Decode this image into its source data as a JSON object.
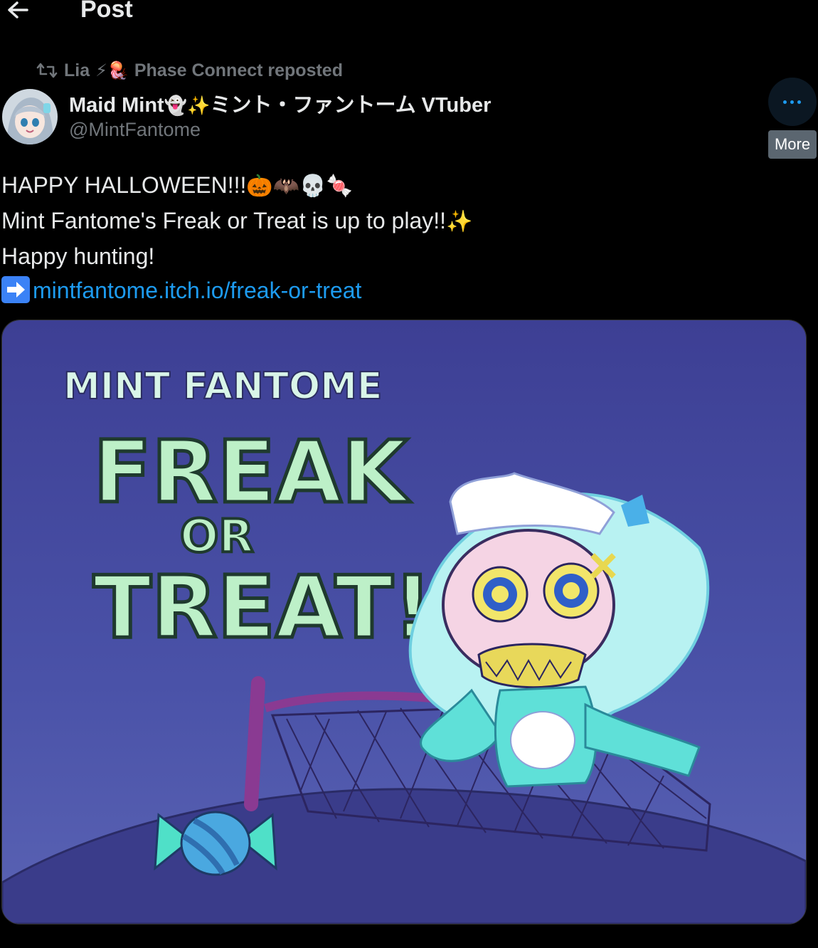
{
  "header": {
    "title": "Post"
  },
  "repost": {
    "user": "Lia",
    "emoji": "⚡🪼",
    "label": "Phase Connect reposted"
  },
  "author": {
    "display_name_prefix": "Maid Mint",
    "display_name_emoji": "👻✨",
    "display_name_suffix": "ミント・ファントーム VTuber",
    "handle": "@MintFantome"
  },
  "more": {
    "tooltip": "More"
  },
  "post": {
    "line1_text": "HAPPY HALLOWEEN!!!",
    "line1_emoji": "🎃🦇💀🍬",
    "line2_text": "Mint Fantome's Freak or Treat is up to play!!",
    "line2_emoji": "✨",
    "line3_text": "Happy hunting!",
    "link_text": "mintfantome.itch.io/freak-or-treat"
  },
  "image": {
    "brand": "MINT FANTOME",
    "title_line1": "FREAK",
    "title_line2": "OR",
    "title_line3": "TREAT!"
  },
  "colors": {
    "accent": "#1d9bf0",
    "muted": "#71767b",
    "background": "#000000",
    "image_bg": "#4a4fa3"
  },
  "icons": [
    "back-arrow-icon",
    "repost-icon",
    "more-icon",
    "arrow-right-icon"
  ]
}
